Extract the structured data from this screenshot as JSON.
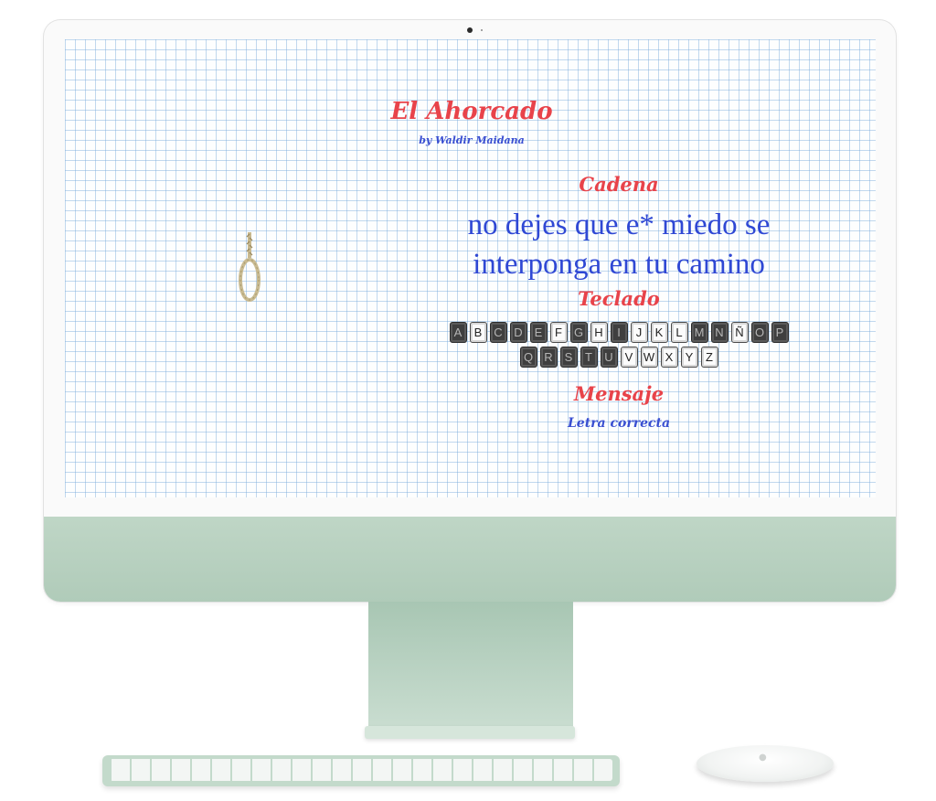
{
  "app": {
    "title": "El Ahorcado",
    "byline": "by Waldir Maidana"
  },
  "sections": {
    "cadena_heading": "Cadena",
    "teclado_heading": "Teclado",
    "mensaje_heading": "Mensaje"
  },
  "phrase": {
    "line1": "no dejes que e* miedo se",
    "line2": "interponga en tu camino"
  },
  "keyboard": {
    "row1": [
      {
        "letter": "A",
        "state": "pressed"
      },
      {
        "letter": "B",
        "state": "unused"
      },
      {
        "letter": "C",
        "state": "pressed"
      },
      {
        "letter": "D",
        "state": "pressed"
      },
      {
        "letter": "E",
        "state": "pressed"
      },
      {
        "letter": "F",
        "state": "unused"
      },
      {
        "letter": "G",
        "state": "pressed"
      },
      {
        "letter": "H",
        "state": "unused"
      },
      {
        "letter": "I",
        "state": "pressed"
      },
      {
        "letter": "J",
        "state": "unused"
      },
      {
        "letter": "K",
        "state": "unused"
      },
      {
        "letter": "L",
        "state": "unused"
      },
      {
        "letter": "M",
        "state": "pressed"
      },
      {
        "letter": "N",
        "state": "pressed"
      },
      {
        "letter": "Ñ",
        "state": "unused"
      },
      {
        "letter": "O",
        "state": "pressed"
      },
      {
        "letter": "P",
        "state": "pressed"
      }
    ],
    "row2": [
      {
        "letter": "Q",
        "state": "pressed"
      },
      {
        "letter": "R",
        "state": "pressed"
      },
      {
        "letter": "S",
        "state": "pressed"
      },
      {
        "letter": "T",
        "state": "pressed"
      },
      {
        "letter": "U",
        "state": "pressed"
      },
      {
        "letter": "V",
        "state": "unused"
      },
      {
        "letter": "W",
        "state": "unused"
      },
      {
        "letter": "X",
        "state": "unused"
      },
      {
        "letter": "Y",
        "state": "unused"
      },
      {
        "letter": "Z",
        "state": "unused"
      }
    ]
  },
  "message": {
    "text": "Letra correcta"
  },
  "icons": {
    "hangman": "noose-icon"
  },
  "colors": {
    "heading_red": "#e8434a",
    "phrase_blue": "#2f48d4",
    "accent_blue": "#3a4fd1",
    "key_pressed": "#3f3f3f",
    "key_unused": "#fbfbfb",
    "monitor_green": "#bfd6c6"
  }
}
